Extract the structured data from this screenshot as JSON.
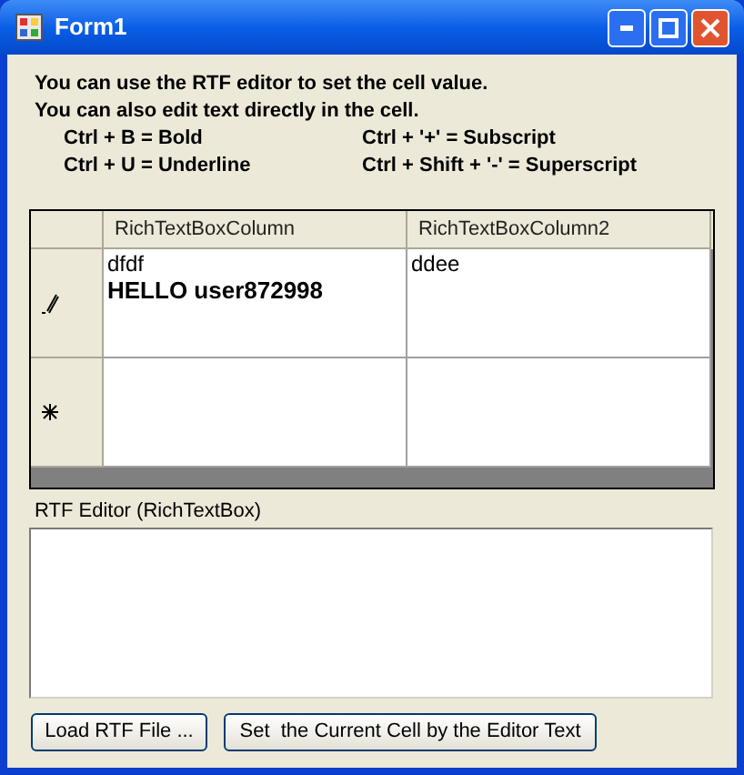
{
  "window": {
    "title": "Form1"
  },
  "instructions": [
    "You can use the RTF editor to set the cell value.",
    "You can also edit text directly in the cell."
  ],
  "shortcuts": [
    "Ctrl + B = Bold",
    "Ctrl + '+' = Subscript",
    "Ctrl + U = Underline",
    "Ctrl + Shift + '-' = Superscript"
  ],
  "grid": {
    "columns": [
      "RichTextBoxColumn",
      "RichTextBoxColumn2"
    ],
    "rows": [
      {
        "kind": "editing",
        "cells": [
          [
            {
              "text": "dfdf",
              "bold": false
            },
            {
              "text": "HELLO user872998",
              "bold": true
            }
          ],
          [
            {
              "text": "ddee",
              "bold": false
            }
          ]
        ]
      },
      {
        "kind": "new",
        "cells": [
          [],
          []
        ]
      }
    ]
  },
  "editor": {
    "label": "RTF Editor (RichTextBox)"
  },
  "buttons": [
    "Load RTF File ...",
    "Set  the Current Cell by the Editor Text"
  ]
}
